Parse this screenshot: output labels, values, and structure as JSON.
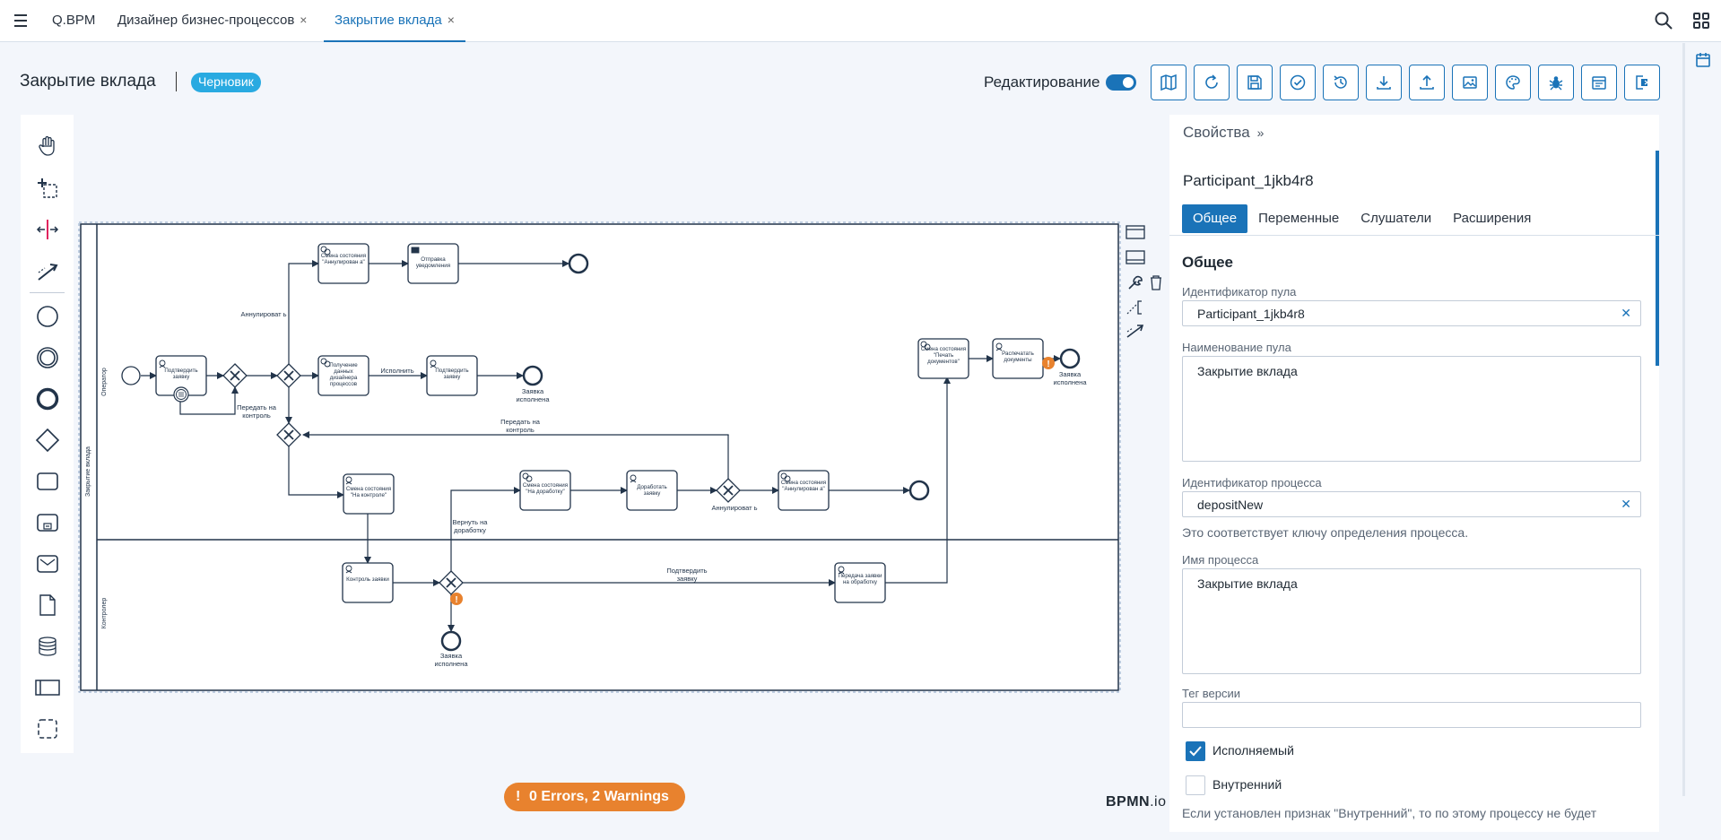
{
  "app": {
    "brand": "Q.BPM"
  },
  "tabs": [
    {
      "label": "Дизайнер бизнес-процессов",
      "close": "×"
    },
    {
      "label": "Закрытие вклада",
      "close": "×"
    }
  ],
  "header": {
    "title": "Закрытие вклада",
    "badge": "Черновик",
    "edit_label": "Редактирование",
    "edit_enabled": true
  },
  "toolbar": {
    "buttons": [
      "map-icon",
      "refresh-icon",
      "save-icon",
      "validate-icon",
      "history-icon",
      "download-icon",
      "upload-icon",
      "image-icon",
      "palette-icon",
      "debug-icon",
      "calendar-icon",
      "exit-icon"
    ]
  },
  "palette": {
    "tools": [
      "hand-tool-icon",
      "lasso-tool-icon",
      "space-tool-icon",
      "connect-tool-icon",
      "start-event-icon",
      "intermediate-event-icon",
      "end-event-icon",
      "gateway-icon",
      "task-icon",
      "subprocess-icon",
      "message-task-icon",
      "data-object-icon",
      "data-store-icon",
      "pool-icon",
      "group-icon"
    ]
  },
  "diagram": {
    "pool_name": "Закрытие вклада",
    "lane_top": "Оператор",
    "lane_bottom": "Контролер",
    "tasks": {
      "confirm_request": "Подтвердить заявку",
      "state_cancelled_1": "Смена состояния \"Аннулирован а\"",
      "send_notification": "Отправка уведомления",
      "get_designer_data": "Получение данных дизайнера процессов",
      "confirm_request_2": "Подтвердить заявку",
      "state_print_docs": "Смена состояния \"Печать документов\"",
      "print_docs": "Распечатать документы",
      "state_control": "Смена состояния \"На контроле\"",
      "state_rework": "Смена состояния \"На доработку\"",
      "rework_request": "Доработать заявку",
      "state_cancelled_2": "Смена состояния \"Аннулирован а\"",
      "control_request": "Контроль заявки",
      "send_to_processing": "Передача заявки на обработку"
    },
    "labels": {
      "cancel_1": "Аннулироват ь",
      "execute": "Исполнить",
      "to_control_1": "Передать на контроль",
      "to_control_2": "Передать на контроль",
      "request_done_1": "Заявка исполнена",
      "request_done_2": "Заявка исполнена",
      "request_done_3": "Заявка исполнена",
      "return_rework": "Вернуть на доработку",
      "cancel_2": "Аннулироват ь",
      "confirm_request_flow": "Подтвердить заявку"
    }
  },
  "properties": {
    "header": "Свойства",
    "element_id": "Participant_1jkb4r8",
    "tabs": [
      "Общее",
      "Переменные",
      "Слушатели",
      "Расширения"
    ],
    "section": "Общее",
    "pool_id_label": "Идентификатор пула",
    "pool_id_value": "Participant_1jkb4r8",
    "pool_name_label": "Наименование пула",
    "pool_name_value": "Закрытие вклада",
    "process_id_label": "Идентификатор процесса",
    "process_id_value": "depositNew",
    "process_id_hint": "Это соответствует ключу определения процесса.",
    "process_name_label": "Имя процесса",
    "process_name_value": "Закрытие вклада",
    "version_tag_label": "Тег версии",
    "version_tag_value": "",
    "executable_label": "Исполняемый",
    "executable_checked": true,
    "internal_label": "Внутренний",
    "internal_checked": false,
    "internal_hint": "Если установлен признак \"Внутренний\", то по этому процессу не будет"
  },
  "status": {
    "text": "0 Errors, 2 Warnings",
    "icon": "!"
  },
  "footer": {
    "logo_bold": "BPMN",
    "logo_rest": ".io"
  },
  "colors": {
    "accent": "#1a73b8",
    "badge": "#29aae1",
    "warning": "#e8822e",
    "diagram_stroke": "#22344a"
  }
}
